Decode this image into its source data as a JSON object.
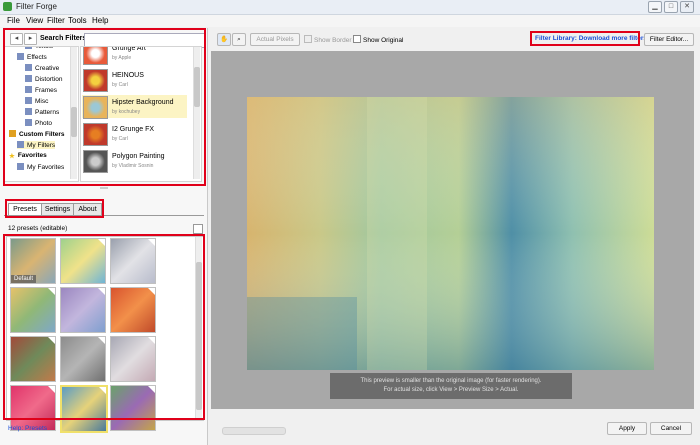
{
  "window": {
    "title": "Filter Forge"
  },
  "menu": [
    "File",
    "View",
    "Filter",
    "Tools",
    "Help"
  ],
  "search": {
    "label": "Search Filters:",
    "value": ""
  },
  "tree": {
    "items": [
      {
        "label": "Textile",
        "indent": 2,
        "icon": "folder-icon"
      },
      {
        "label": "Effects",
        "indent": 1,
        "icon": "folder-icon"
      },
      {
        "label": "Creative",
        "indent": 2,
        "icon": "folder-icon"
      },
      {
        "label": "Distortion",
        "indent": 2,
        "icon": "folder-icon"
      },
      {
        "label": "Frames",
        "indent": 2,
        "icon": "folder-icon"
      },
      {
        "label": "Misc",
        "indent": 2,
        "icon": "folder-icon"
      },
      {
        "label": "Patterns",
        "indent": 2,
        "icon": "folder-icon"
      },
      {
        "label": "Photo",
        "indent": 2,
        "icon": "folder-icon"
      },
      {
        "label": "Custom Filters",
        "indent": 0,
        "icon": "custom-filters-icon",
        "bold": true
      },
      {
        "label": "My Filters",
        "indent": 1,
        "icon": "folder-icon",
        "selected": true
      },
      {
        "label": "Favorites",
        "indent": 0,
        "icon": "star-icon",
        "bold": true
      },
      {
        "label": "My Favorites",
        "indent": 1,
        "icon": "folder-icon"
      }
    ]
  },
  "filters": [
    {
      "name": "Grunge Art",
      "author": "by Apple",
      "colors": [
        "#e85a3a",
        "#ffffff"
      ]
    },
    {
      "name": "HEINOUS",
      "author": "by Carl",
      "colors": [
        "#c0392b",
        "#f4d03f"
      ]
    },
    {
      "name": "Hipster Background",
      "author": "by kochubey",
      "colors": [
        "#e8b45a",
        "#9bc8d6"
      ],
      "selected": true
    },
    {
      "name": "I2 Grunge FX",
      "author": "by Carl",
      "colors": [
        "#c0392b",
        "#e67e22"
      ]
    },
    {
      "name": "Polygon Painting",
      "author": "by Vladimir Sosnin",
      "colors": [
        "#555555",
        "#cccccc"
      ]
    }
  ],
  "tabs": [
    "Presets",
    "Settings",
    "About"
  ],
  "presets": {
    "count_label": "12 presets (editable)",
    "default_label": "Default",
    "items": [
      {
        "colors": [
          "#7b9a8a",
          "#d9b472",
          "#8aa7b8"
        ]
      },
      {
        "colors": [
          "#9fd18c",
          "#f0e28a",
          "#6fb5d6"
        ]
      },
      {
        "colors": [
          "#9aa0ad",
          "#e2e2e6",
          "#b8bccc"
        ]
      },
      {
        "colors": [
          "#e6c26a",
          "#90b877",
          "#7fa8c8"
        ]
      },
      {
        "colors": [
          "#9b87c0",
          "#c2b6dd",
          "#7f9fcf"
        ]
      },
      {
        "colors": [
          "#d9542e",
          "#f2904a",
          "#c04a2a"
        ]
      },
      {
        "colors": [
          "#a24a3a",
          "#6f8a5a",
          "#c27a4a"
        ]
      },
      {
        "colors": [
          "#8c8c8c",
          "#b5b5b5",
          "#707070"
        ]
      },
      {
        "colors": [
          "#a8a8b4",
          "#e1dde0",
          "#c4a9b4"
        ]
      },
      {
        "colors": [
          "#e0346a",
          "#f06a8a",
          "#c22a5a"
        ]
      },
      {
        "colors": [
          "#5a9cc4",
          "#e6d27a",
          "#4a7a9a"
        ],
        "selected": true
      },
      {
        "colors": [
          "#6aa26a",
          "#9a6ab4",
          "#c4a44a"
        ]
      }
    ]
  },
  "help": {
    "label": "Help: Presets"
  },
  "toolbar": {
    "actual_pixels": "Actual Pixels",
    "show_border": "Show Border",
    "show_original": "Show Original",
    "library_link": "Filter Library: Download more filters",
    "filter_editor": "Filter Editor..."
  },
  "preview": {
    "note_line1": "This preview is smaller than the original image (for faster rendering).",
    "note_line2": "For actual size, click View > Preview Size > Actual."
  },
  "actions": {
    "apply": "Apply",
    "cancel": "Cancel"
  },
  "colors": {
    "highlight_box": "#e0001a",
    "link": "#1b4fd8",
    "selection": "#fcf4c4"
  }
}
